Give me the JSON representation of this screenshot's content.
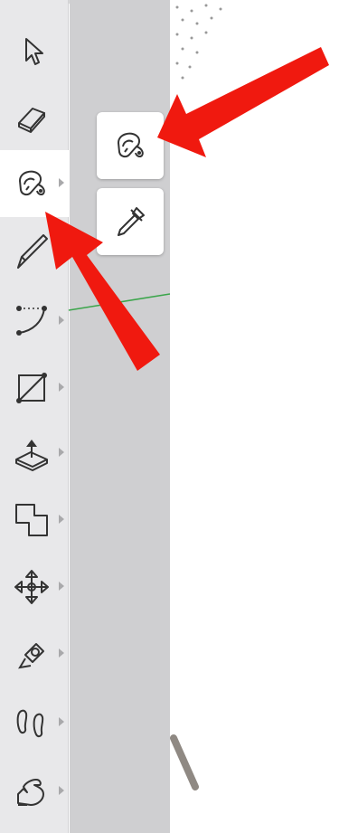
{
  "toolbar": {
    "tools": [
      {
        "name": "select",
        "icon": "arrow-cursor-icon",
        "has_submenu": false,
        "active": false
      },
      {
        "name": "eraser",
        "icon": "eraser-icon",
        "has_submenu": false,
        "active": false
      },
      {
        "name": "paint-bucket",
        "icon": "paint-bucket-icon",
        "has_submenu": true,
        "active": true
      },
      {
        "name": "line",
        "icon": "pencil-icon",
        "has_submenu": true,
        "active": false
      },
      {
        "name": "arc",
        "icon": "arc-icon",
        "has_submenu": true,
        "active": false
      },
      {
        "name": "rectangle",
        "icon": "rectangle-icon",
        "has_submenu": true,
        "active": false
      },
      {
        "name": "push-pull",
        "icon": "push-pull-icon",
        "has_submenu": true,
        "active": false
      },
      {
        "name": "offset",
        "icon": "offset-icon",
        "has_submenu": true,
        "active": false
      },
      {
        "name": "move",
        "icon": "move-arrows-icon",
        "has_submenu": true,
        "active": false
      },
      {
        "name": "tape-measure",
        "icon": "tape-measure-icon",
        "has_submenu": true,
        "active": false
      },
      {
        "name": "walk",
        "icon": "footprints-icon",
        "has_submenu": true,
        "active": false
      },
      {
        "name": "pan",
        "icon": "hand-icon",
        "has_submenu": true,
        "active": false
      }
    ]
  },
  "flyout": {
    "items": [
      {
        "name": "paint-bucket",
        "icon": "paint-bucket-icon"
      },
      {
        "name": "sample-paint",
        "icon": "eyedropper-icon"
      }
    ]
  },
  "annotations": {
    "arrow_color": "#f0190f"
  },
  "colors": {
    "toolbar_bg": "#e8e8ea",
    "panel_bg": "#cfcfd1",
    "active_tool_bg": "#ffffff",
    "axis_green": "#3aa54a"
  }
}
